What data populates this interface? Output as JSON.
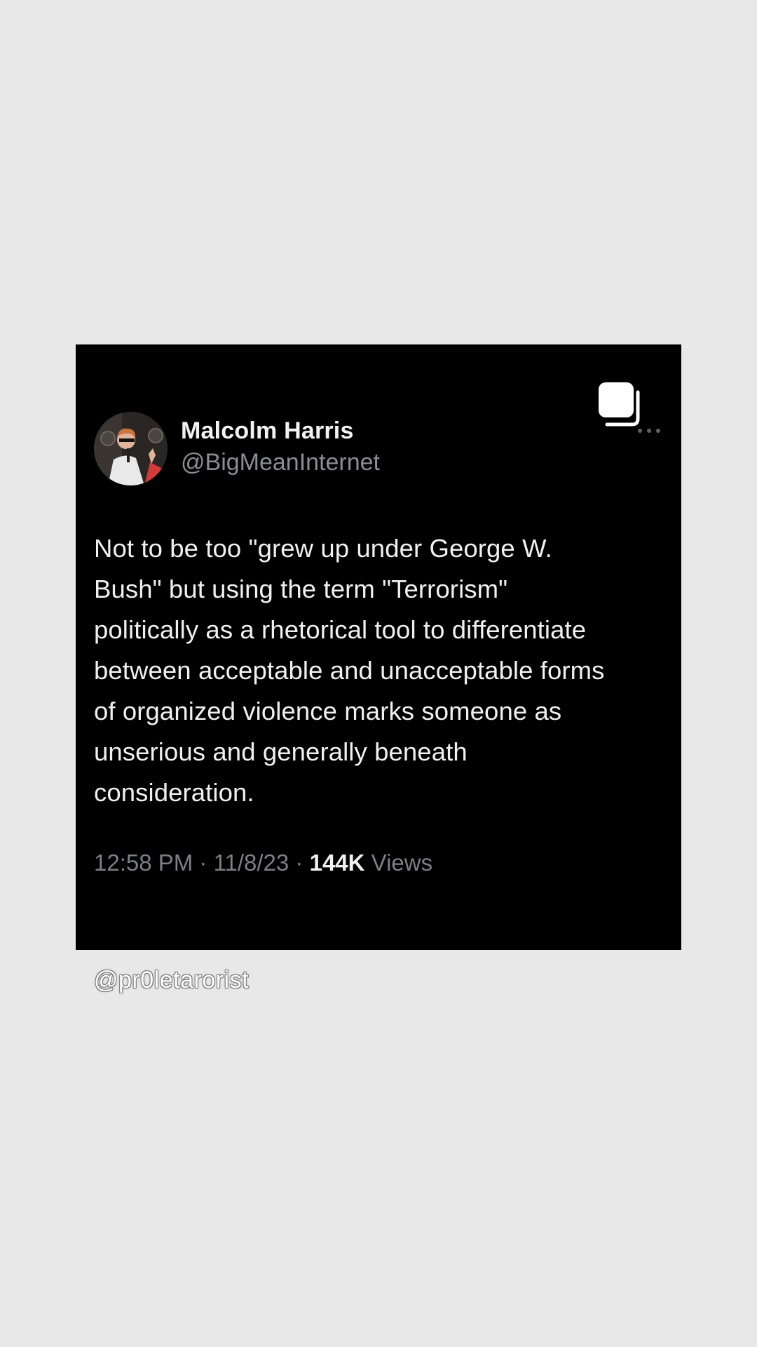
{
  "tweet": {
    "display_name": "Malcolm Harris",
    "handle": "@BigMeanInternet",
    "text": "Not to be too \"grew up under George W.\nBush\" but using the term \"Terrorism\"\npolitically as a rhetorical tool to differentiate\nbetween acceptable and unacceptable forms\nof organized violence marks someone as\nunserious and generally beneath\nconsideration.",
    "time": "12:58 PM",
    "date": "11/8/23",
    "separator": "·",
    "views_count": "144K",
    "views_label": "Views"
  },
  "icons": {
    "multi_post": "multiple-images-icon",
    "more": "more-dots-icon",
    "avatar": "avatar-photo"
  },
  "watermark": {
    "text": "@pr0letarorist"
  },
  "colors": {
    "page_background": "#e8e8e8",
    "card_background": "#000000",
    "primary_text": "#f0f0f0",
    "secondary_text": "#8a8d91"
  }
}
